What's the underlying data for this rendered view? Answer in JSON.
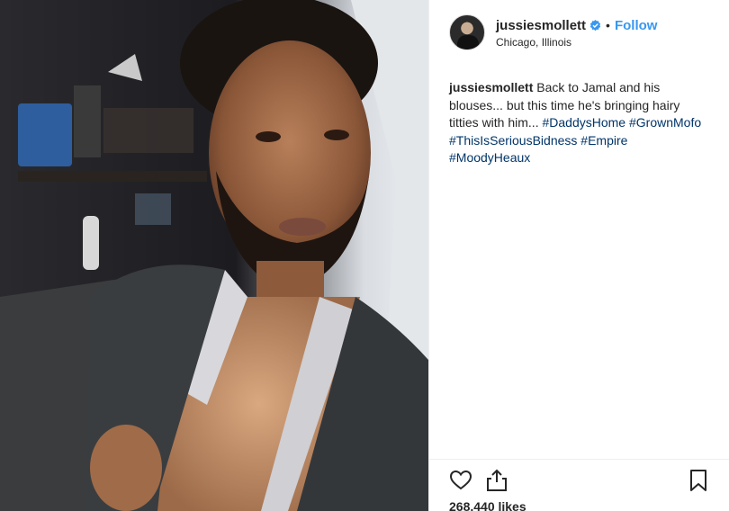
{
  "post": {
    "username": "jussiesmollett",
    "location": "Chicago, Illinois",
    "separator": "•",
    "follow_label": "Follow",
    "icons": {
      "verified": "verified-badge-icon",
      "heart": "heart-icon",
      "share": "share-icon",
      "bookmark": "bookmark-icon"
    },
    "caption": {
      "username": "jussiesmollett",
      "text": "Back to Jamal and his blouses... but this time he's bringing hairy titties with him...",
      "hashtags": [
        "#DaddysHome",
        "#GrownMofo",
        "#ThisIsSeriousBidness",
        "#Empire",
        "#MoodyHeaux"
      ]
    },
    "likes": "268,440 likes"
  },
  "colors": {
    "link_blue": "#3897f0",
    "hashtag_blue": "#003569",
    "text": "#262626",
    "divider": "#efefef"
  }
}
